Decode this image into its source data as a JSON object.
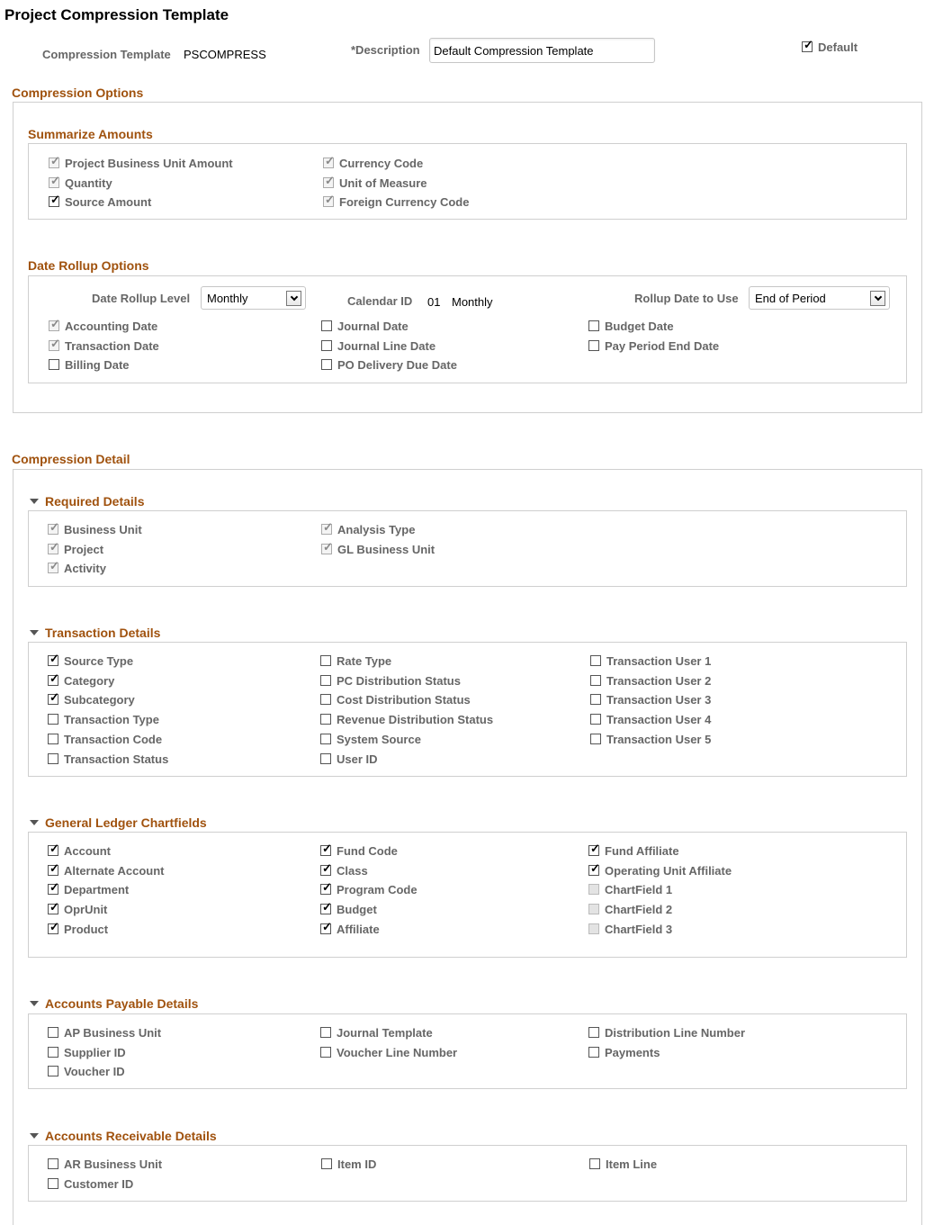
{
  "page_title": "Project Compression Template",
  "header": {
    "template_label": "Compression Template",
    "template_value": "PSCOMPRESS",
    "description_label": "*Description",
    "description_value": "Default Compression Template",
    "default_label": "Default",
    "default_state": "checked"
  },
  "compression_options": {
    "title": "Compression Options",
    "summarize": {
      "title": "Summarize Amounts",
      "items": [
        {
          "label": "Project Business Unit Amount",
          "state": "disabled-checked"
        },
        {
          "label": "Quantity",
          "state": "disabled-checked"
        },
        {
          "label": "Source Amount",
          "state": "checked"
        },
        {
          "label": "Currency Code",
          "state": "disabled-checked"
        },
        {
          "label": "Unit of Measure",
          "state": "disabled-checked"
        },
        {
          "label": "Foreign Currency Code",
          "state": "disabled-checked"
        }
      ]
    },
    "date_rollup": {
      "title": "Date Rollup Options",
      "level_label": "Date Rollup Level",
      "level_value": "Monthly",
      "calendar_label": "Calendar ID",
      "calendar_id": "01",
      "calendar_desc": "Monthly",
      "rollup_date_label": "Rollup Date to Use",
      "rollup_date_value": "End of Period",
      "items": [
        {
          "label": "Accounting Date",
          "state": "disabled-checked"
        },
        {
          "label": "Transaction Date",
          "state": "disabled-checked"
        },
        {
          "label": "Billing Date",
          "state": "unchecked"
        },
        {
          "label": "Journal Date",
          "state": "unchecked"
        },
        {
          "label": "Journal Line Date",
          "state": "unchecked"
        },
        {
          "label": "PO Delivery Due Date",
          "state": "unchecked"
        },
        {
          "label": "Budget Date",
          "state": "unchecked"
        },
        {
          "label": "Pay Period End Date",
          "state": "unchecked"
        }
      ]
    }
  },
  "compression_detail": {
    "title": "Compression Detail",
    "required": {
      "title": "Required Details",
      "items": [
        {
          "label": "Business Unit",
          "state": "disabled-checked"
        },
        {
          "label": "Project",
          "state": "disabled-checked"
        },
        {
          "label": "Activity",
          "state": "disabled-checked"
        },
        {
          "label": "Analysis Type",
          "state": "disabled-checked"
        },
        {
          "label": "GL Business Unit",
          "state": "disabled-checked"
        }
      ]
    },
    "transaction": {
      "title": "Transaction Details",
      "items": [
        {
          "label": "Source Type",
          "state": "checked"
        },
        {
          "label": "Category",
          "state": "checked"
        },
        {
          "label": "Subcategory",
          "state": "checked"
        },
        {
          "label": "Transaction Type",
          "state": "unchecked"
        },
        {
          "label": "Transaction Code",
          "state": "unchecked"
        },
        {
          "label": "Transaction Status",
          "state": "unchecked"
        },
        {
          "label": "Rate Type",
          "state": "unchecked"
        },
        {
          "label": "PC Distribution Status",
          "state": "unchecked"
        },
        {
          "label": "Cost Distribution Status",
          "state": "unchecked"
        },
        {
          "label": "Revenue Distribution Status",
          "state": "unchecked"
        },
        {
          "label": "System Source",
          "state": "unchecked"
        },
        {
          "label": "User ID",
          "state": "unchecked"
        },
        {
          "label": "Transaction User 1",
          "state": "unchecked"
        },
        {
          "label": "Transaction User 2",
          "state": "unchecked"
        },
        {
          "label": "Transaction User 3",
          "state": "unchecked"
        },
        {
          "label": "Transaction User 4",
          "state": "unchecked"
        },
        {
          "label": "Transaction User 5",
          "state": "unchecked"
        }
      ]
    },
    "gl": {
      "title": "General Ledger Chartfields",
      "items": [
        {
          "label": "Account",
          "state": "checked"
        },
        {
          "label": "Alternate Account",
          "state": "checked"
        },
        {
          "label": "Department",
          "state": "checked"
        },
        {
          "label": "OprUnit",
          "state": "checked"
        },
        {
          "label": "Product",
          "state": "checked"
        },
        {
          "label": "Fund Code",
          "state": "checked"
        },
        {
          "label": "Class",
          "state": "checked"
        },
        {
          "label": "Program Code",
          "state": "checked"
        },
        {
          "label": "Budget",
          "state": "checked"
        },
        {
          "label": "Affiliate",
          "state": "checked"
        },
        {
          "label": "Fund Affiliate",
          "state": "checked"
        },
        {
          "label": "Operating Unit Affiliate",
          "state": "checked"
        },
        {
          "label": "ChartField 1",
          "state": "disabled-unchecked"
        },
        {
          "label": "ChartField 2",
          "state": "disabled-unchecked"
        },
        {
          "label": "ChartField 3",
          "state": "disabled-unchecked"
        }
      ]
    },
    "ap": {
      "title": "Accounts Payable Details",
      "items": [
        {
          "label": "AP Business Unit",
          "state": "unchecked"
        },
        {
          "label": "Supplier ID",
          "state": "unchecked"
        },
        {
          "label": "Voucher ID",
          "state": "unchecked"
        },
        {
          "label": "Journal Template",
          "state": "unchecked"
        },
        {
          "label": "Voucher Line Number",
          "state": "unchecked"
        },
        {
          "label": "Distribution Line Number",
          "state": "unchecked"
        },
        {
          "label": "Payments",
          "state": "unchecked"
        }
      ]
    },
    "ar": {
      "title": "Accounts Receivable Details",
      "items": [
        {
          "label": "AR Business Unit",
          "state": "unchecked"
        },
        {
          "label": "Customer ID",
          "state": "unchecked"
        },
        {
          "label": "Item ID",
          "state": "unchecked"
        },
        {
          "label": "Item Line",
          "state": "unchecked"
        }
      ]
    }
  }
}
